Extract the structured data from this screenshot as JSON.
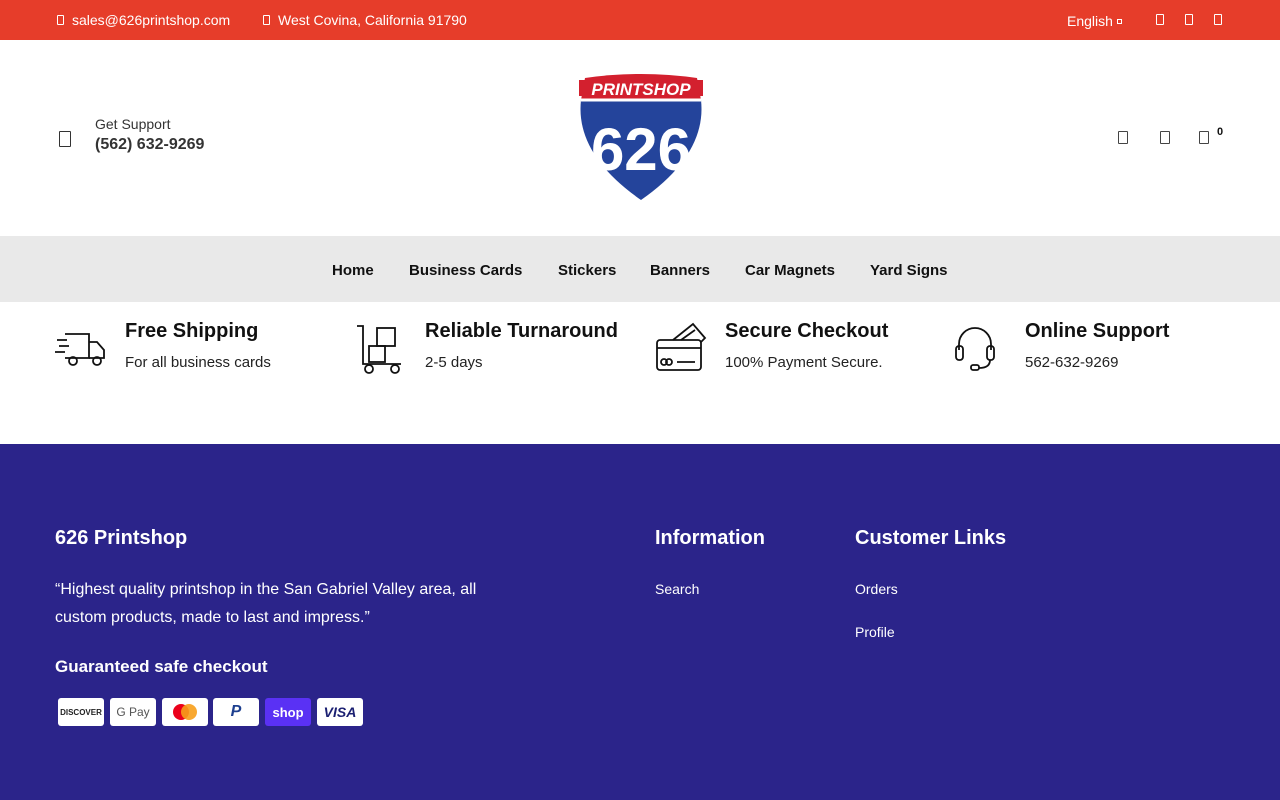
{
  "topbar": {
    "email": "sales@626printshop.com",
    "address": "West Covina, California 91790",
    "language": "English",
    "social_icons": [
      "facebook-icon",
      "instagram-icon",
      "twitter-icon"
    ]
  },
  "header": {
    "support_label": "Get Support",
    "support_phone": "(562) 632-9269",
    "logo": {
      "top_text": "PRINTSHOP",
      "number": "626"
    },
    "cart_count": "0",
    "icons": [
      "search-icon",
      "user-icon",
      "cart-icon"
    ]
  },
  "nav": {
    "items": [
      {
        "label": "Home"
      },
      {
        "label": "Business Cards"
      },
      {
        "label": "Stickers"
      },
      {
        "label": "Banners"
      },
      {
        "label": "Car Magnets"
      },
      {
        "label": "Yard Signs"
      }
    ]
  },
  "features": [
    {
      "title": "Free Shipping",
      "subtitle": "For all business cards",
      "icon": "delivery-truck-icon"
    },
    {
      "title": "Reliable Turnaround",
      "subtitle": "2-5 days",
      "icon": "hand-truck-icon"
    },
    {
      "title": "Secure Checkout",
      "subtitle": "100% Payment Secure.",
      "icon": "credit-card-icon"
    },
    {
      "title": "Online Support",
      "subtitle": "562-632-9269",
      "icon": "headset-icon"
    }
  ],
  "footer": {
    "brand_title": "626 Printshop",
    "quote": "“Highest quality printshop in the San Gabriel Valley area, all custom products, made to last and impress.”",
    "guarantee": "Guaranteed safe checkout",
    "information_title": "Information",
    "information_links": [
      "Search"
    ],
    "customer_title": "Customer Links",
    "customer_links": [
      "Orders",
      "Profile"
    ],
    "payment_methods": [
      "DISCOVER",
      "G Pay",
      "mastercard",
      "P",
      "shop",
      "VISA"
    ]
  },
  "colors": {
    "topbar": "#e63d2a",
    "nav_bg": "#e9e9e9",
    "footer_bg": "#2b248a",
    "logo_red": "#d3202e",
    "logo_blue": "#24449b"
  }
}
